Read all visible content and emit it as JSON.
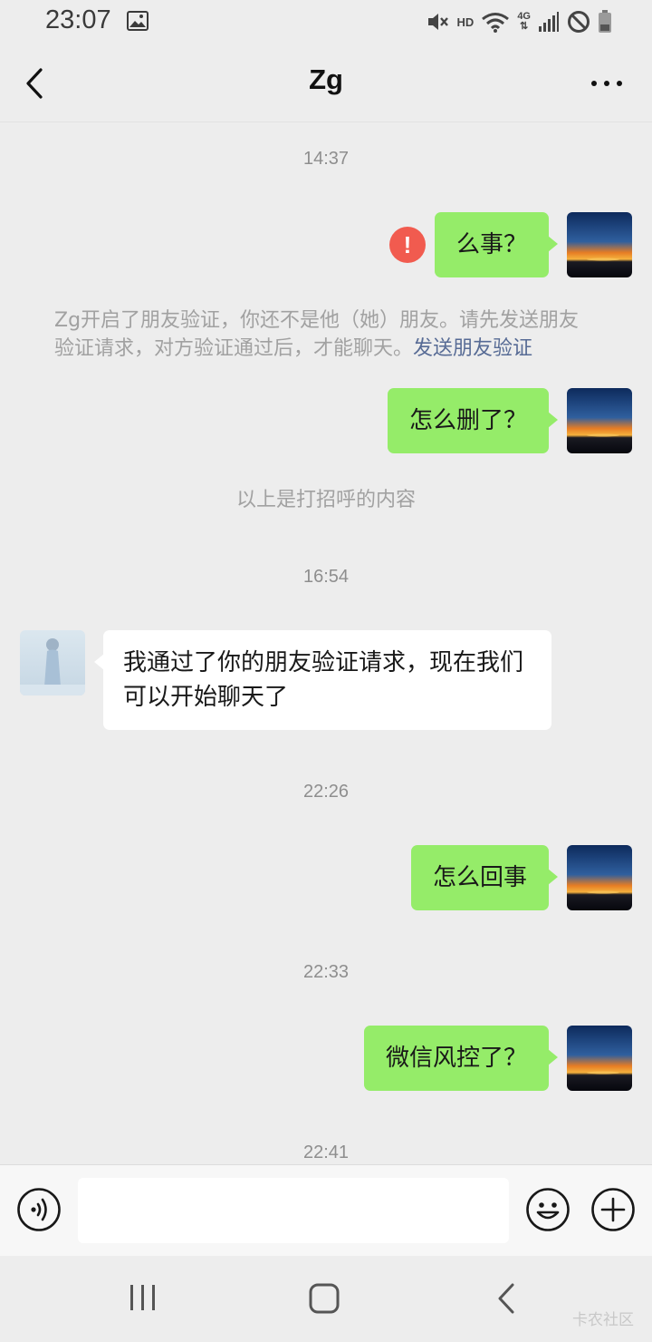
{
  "status_bar": {
    "time": "23:07",
    "hd_label": "HD",
    "network_label": "4G",
    "icons": [
      "gallery-icon",
      "mute-icon",
      "wifi-icon",
      "signal-icon",
      "do-not-disturb-icon",
      "battery-icon"
    ]
  },
  "header": {
    "title": "Zg",
    "back_icon": "chevron-left-icon",
    "more_icon": "more-dots-icon"
  },
  "messages": {
    "ts1": "14:37",
    "m1_text": "么事？",
    "error_mark": "!",
    "system_note_text": "Zg开启了朋友验证，你还不是他（她）朋友。请先发送朋友验证请求，对方验证通过后，才能聊天。",
    "system_note_link": "发送朋友验证",
    "m2_text": "怎么删了？",
    "greeting_note": "以上是打招呼的内容",
    "ts2": "16:54",
    "m3_text": "我通过了你的朋友验证请求，现在我们可以开始聊天了",
    "ts3": "22:26",
    "m4_text": "怎么回事",
    "ts4": "22:33",
    "m5_text": "微信风控了？",
    "ts5": "22:41"
  },
  "input_bar": {
    "placeholder": "",
    "value": "",
    "icons": [
      "voice-icon",
      "emoji-icon",
      "plus-icon"
    ]
  },
  "nav_bar": {
    "icons": [
      "recents-icon",
      "home-icon",
      "back-icon"
    ],
    "watermark": "卡农社区"
  },
  "colors": {
    "background": "#ededed",
    "sent_bubble": "#95ec69",
    "received_bubble": "#ffffff",
    "error": "#f15b4f",
    "link": "#576b95"
  }
}
